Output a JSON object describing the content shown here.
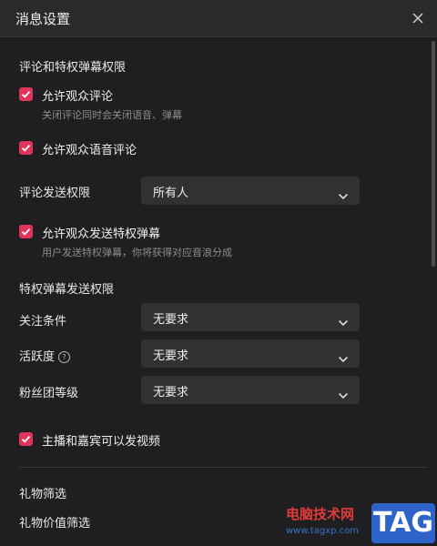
{
  "window": {
    "title": "消息设置"
  },
  "section1": {
    "title": "评论和特权弹幕权限",
    "allow_comments": {
      "label": "允许观众评论",
      "checked": true,
      "hint": "关闭评论同时会关闭语音、弹幕"
    },
    "allow_voice_comments": {
      "label": "允许观众语音评论",
      "checked": true
    },
    "comment_permission": {
      "label": "评论发送权限",
      "value": "所有人"
    },
    "allow_privilege_danmaku": {
      "label": "允许观众发送特权弹幕",
      "checked": true,
      "hint": "用户发送特权弹幕，你将获得对应音浪分成"
    }
  },
  "section2": {
    "title": "特权弹幕发送权限",
    "follow_condition": {
      "label": "关注条件",
      "value": "无要求"
    },
    "activity": {
      "label": "活跃度",
      "value": "无要求"
    },
    "fan_level": {
      "label": "粉丝团等级",
      "value": "无要求"
    }
  },
  "video": {
    "label": "主播和嘉宾可以发视频",
    "checked": true
  },
  "gift": {
    "title": "礼物筛选",
    "value_filter_label": "礼物价值筛选"
  },
  "watermark": {
    "cn": "电脑技术网",
    "url": "www.tagxp.com",
    "tag": "TAG"
  },
  "colors": {
    "accent": "#e0345a",
    "background": "#1f1f21",
    "select_bg": "#313134"
  }
}
